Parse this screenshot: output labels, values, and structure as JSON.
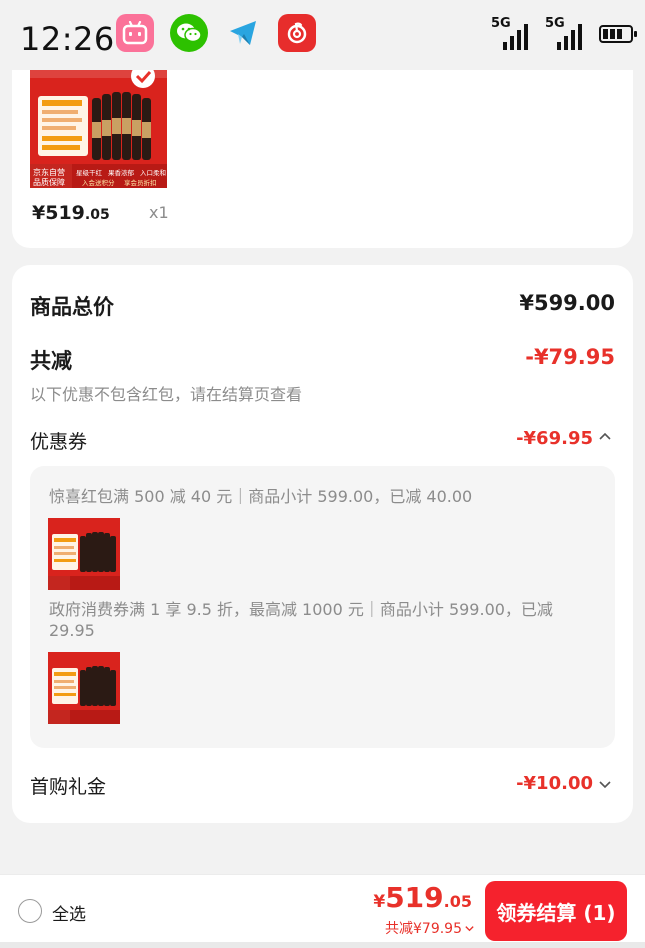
{
  "status_bar": {
    "time": "12:26",
    "signal_1": "5G",
    "signal_2": "5G",
    "app_icons": [
      "bilibili-icon",
      "wechat-icon",
      "telegram-icon",
      "netease-music-icon"
    ]
  },
  "product": {
    "price_symbol": "¥",
    "price_int": "519",
    "price_dec": ".05",
    "quantity": "x1",
    "image_texts": [
      "京东自营",
      "品质保障",
      "星级干红",
      "果香浓郁",
      "入口柔和",
      "入会送积分",
      "享会员折扣"
    ]
  },
  "summary": {
    "total_label": "商品总价",
    "total_value": "¥599.00",
    "reduce_label": "共减",
    "reduce_value": "-¥79.95",
    "note": "以下优惠不包含红包，请在结算页查看"
  },
  "coupons": {
    "label": "优惠券",
    "value": "-¥69.95",
    "items": [
      {
        "text": "惊喜红包满 500 减 40 元｜商品小计 599.00，已减 40.00"
      },
      {
        "text": "政府消费券满 1 享 9.5 折，最高减 1000 元｜商品小计 599.00，已减 29.95"
      }
    ]
  },
  "gift": {
    "label": "首购礼金",
    "value": "-¥10.00"
  },
  "bottom": {
    "select_all": "全选",
    "yen": "¥",
    "total_int": "519",
    "total_dec": ".05",
    "reduce_text": "共减¥79.95",
    "checkout_label": "领券结算 (1)"
  },
  "colors": {
    "accent": "#e8312a",
    "button": "#f5222d",
    "background": "#f2f2f2",
    "muted_text": "#8c8c8c"
  }
}
